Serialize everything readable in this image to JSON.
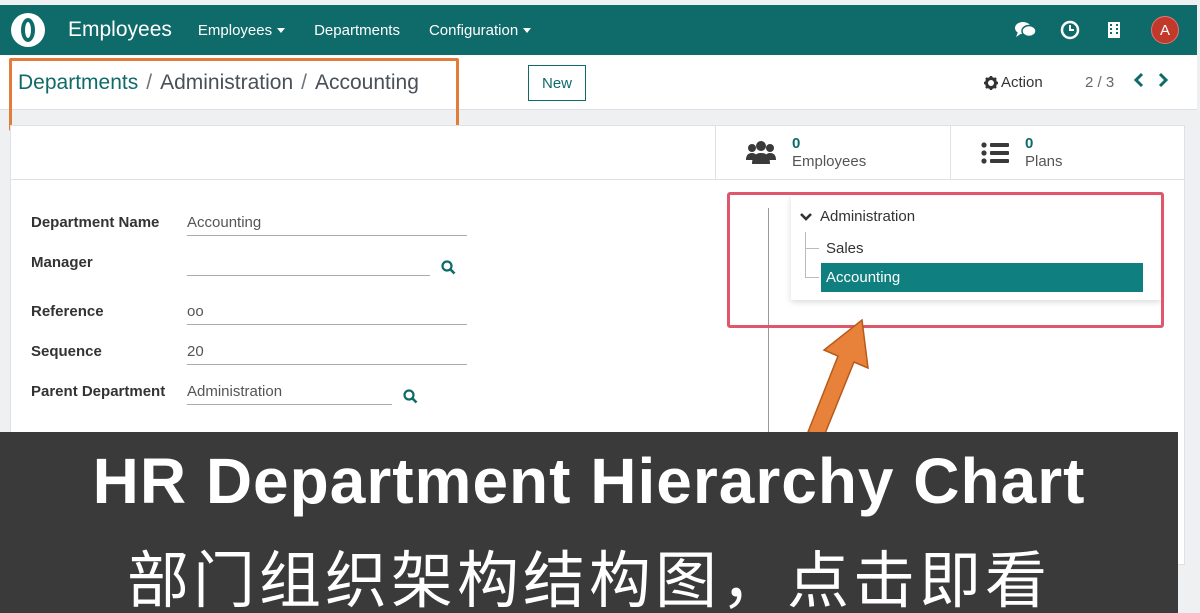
{
  "nav": {
    "app_name": "Employees",
    "menu": [
      "Employees",
      "Departments",
      "Configuration"
    ],
    "avatar_letter": "A",
    "accent": "#0f6a6a"
  },
  "control": {
    "breadcrumb": [
      "Departments",
      "Administration",
      "Accounting"
    ],
    "breadcrumb_sep": "/",
    "new_label": "New",
    "action_label": "Action",
    "pager": "2 / 3"
  },
  "stats": {
    "employees": {
      "count": "0",
      "label": "Employees"
    },
    "plans": {
      "count": "0",
      "label": "Plans"
    }
  },
  "form": {
    "department_name": {
      "label": "Department Name",
      "value": "Accounting"
    },
    "manager": {
      "label": "Manager",
      "value": ""
    },
    "reference": {
      "label": "Reference",
      "value": "oo"
    },
    "sequence": {
      "label": "Sequence",
      "value": "20"
    },
    "parent": {
      "label": "Parent Department",
      "value": "Administration"
    }
  },
  "hierarchy": {
    "root": "Administration",
    "children": [
      "Sales",
      "Accounting"
    ],
    "active": "Accounting"
  },
  "banner": {
    "title": "HR Department Hierarchy Chart",
    "subtitle": "部门组织架构结构图，点击即看"
  }
}
